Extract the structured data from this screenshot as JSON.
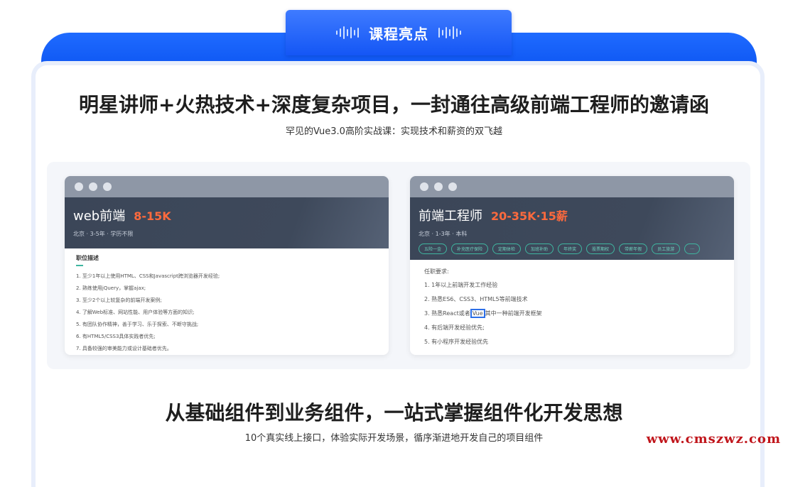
{
  "header": {
    "tab_label": "课程亮点"
  },
  "section1": {
    "headline": "明星讲师+火热技术+深度复杂项目，一封通往高级前端工程师的邀请函",
    "subtitle": "罕见的Vue3.0高阶实战课：实现技术和薪资的双飞越"
  },
  "left_card": {
    "title": "web前端",
    "salary": "8-15K",
    "meta": "北京 · 3-5年 · 学历不限",
    "section_title": "职位描述",
    "items": [
      "1. 至少1年以上使用HTML、CSS和Javascript跨浏览器开发经验;",
      "2. 熟练使用jQuery，掌握ajax;",
      "3. 至少2个以上较复杂的前端开发案例;",
      "4. 了解Web标准、网站性能、用户体验等方面的知识;",
      "5. 有团队协作精神，善于学习、乐于探索、不断守挑战;",
      "6. 有HTML5/CSS3具体实践者优先;",
      "7. 具备较强的审美能力或设计基础者优先。"
    ]
  },
  "right_card": {
    "title": "前端工程师",
    "salary": "20-35K·15薪",
    "meta": "北京 · 1-3年 · 本科",
    "tags": [
      "五险一金",
      "补充医疗保险",
      "定期体检",
      "加班补助",
      "年终奖",
      "股票期权",
      "带薪年假",
      "员工旅游",
      "…"
    ],
    "req_title": "任职要求:",
    "items": [
      "1. 1年以上前端开发工作经验",
      "2. 熟悉ES6、CSS3、HTML5等前端技术",
      "3. 熟悉React或者",
      "4. 有后端开发经验优先;",
      "5. 有小程序开发经验优先"
    ],
    "item3_highlight": "Vue",
    "item3_suffix": "其中一种前端开发框架"
  },
  "section2": {
    "headline": "从基础组件到业务组件，一站式掌握组件化开发思想",
    "subtitle": "10个真实线上接口，体验实际开发场景，循序渐进地开发自己的项目组件"
  },
  "watermark": "www.cmszwz.com",
  "colors": {
    "brand_blue": "#1456f5",
    "salary_orange": "#ff6a3d",
    "tag_green": "#3fb6a0"
  }
}
